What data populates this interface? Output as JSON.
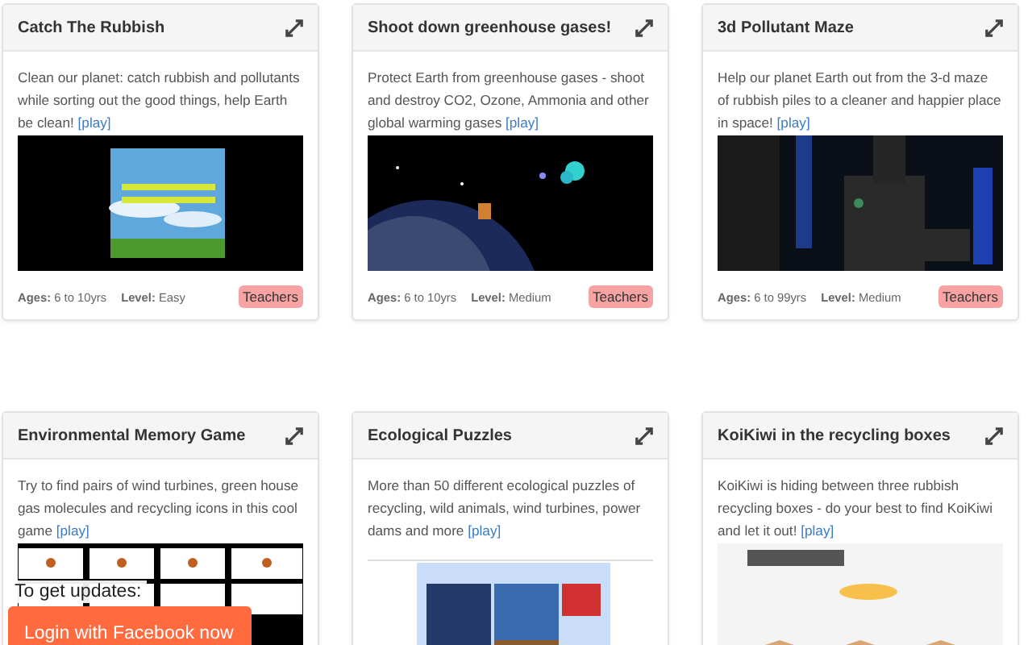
{
  "games": [
    {
      "title": "Catch The Rubbish",
      "description": "Clean our planet: catch rubbish and pollutants while sorting out the good things, help Earth be clean!",
      "link": "[play]",
      "ages": "**Ages:** 6 to 10yrs",
      "level": "**Level:** Easy",
      "badge": "Teachers"
    },
    {
      "title": "Shoot down greenhouse gases!",
      "description": "Protect Earth from greenhouse gases - shoot and destroy CO2, Ozone, Ammonia and other global warming gases",
      "link": "[play]",
      "ages": "**Ages:** 6 to 10yrs",
      "level": "**Level:** Medium",
      "badge": "Teachers"
    },
    {
      "title": "3d Pollutant Maze",
      "description": "Help our planet Earth out from the 3-d maze of rubbish piles to a cleaner and happier place in space!",
      "link": "[play]",
      "ages": "**Ages:** 6 to 99yrs",
      "level": "**Level:** Medium",
      "badge": "Teachers"
    },
    {
      "title": "Environmental Memory Game",
      "description": "Try to find pairs of wind turbines, green house gas molecules and recycling icons in this cool game",
      "link": "[play]"
    },
    {
      "title": "Ecological Puzzles",
      "description": "More than 50 different ecological puzzles of recycling, wild animals, wind turbines, power dams and more",
      "link": "[play]"
    },
    {
      "title": "KoiKiwi in the recycling boxes",
      "description": "KoiKiwi is hiding between three rubbish recycling boxes - do your best to find KoiKiwi and let it out!",
      "link": "[play]"
    }
  ],
  "updates": {
    "label": "To get updates:",
    "button": "Login with Facebook now"
  }
}
